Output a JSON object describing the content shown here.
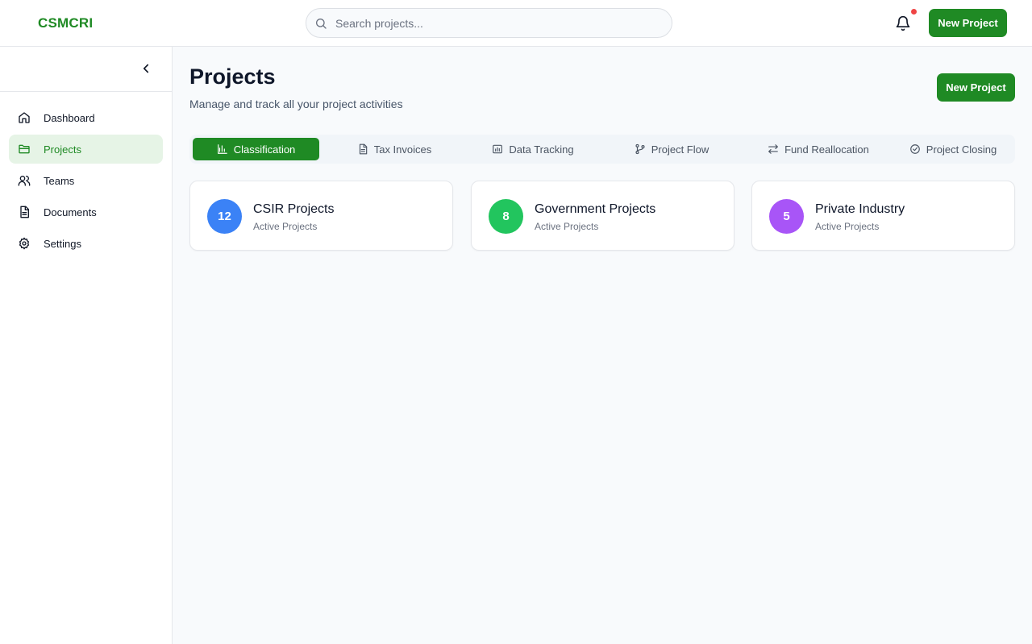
{
  "header": {
    "logo": "CSMCRI",
    "search_placeholder": "Search projects...",
    "new_project_label": "New Project"
  },
  "sidebar": {
    "items": [
      {
        "label": "Dashboard",
        "icon": "home-icon"
      },
      {
        "label": "Projects",
        "icon": "folder-icon",
        "active": true
      },
      {
        "label": "Teams",
        "icon": "users-icon"
      },
      {
        "label": "Documents",
        "icon": "document-icon"
      },
      {
        "label": "Settings",
        "icon": "gear-icon"
      }
    ]
  },
  "main": {
    "title": "Projects",
    "subtitle": "Manage and track all your project activities",
    "new_project_label": "New Project",
    "tabs": [
      {
        "label": "Classification",
        "icon": "bar-chart-icon",
        "active": true
      },
      {
        "label": "Tax Invoices",
        "icon": "file-text-icon"
      },
      {
        "label": "Data Tracking",
        "icon": "calendar-chart-icon"
      },
      {
        "label": "Project Flow",
        "icon": "git-branch-icon"
      },
      {
        "label": "Fund Reallocation",
        "icon": "swap-arrows-icon"
      },
      {
        "label": "Project Closing",
        "icon": "check-circle-icon"
      }
    ],
    "cards": [
      {
        "count": "12",
        "title": "CSIR Projects",
        "subtitle": "Active Projects",
        "color": "#3b82f6"
      },
      {
        "count": "8",
        "title": "Government Projects",
        "subtitle": "Active Projects",
        "color": "#22c55e"
      },
      {
        "count": "5",
        "title": "Private Industry",
        "subtitle": "Active Projects",
        "color": "#a855f7"
      }
    ]
  },
  "colors": {
    "brand": "#1f8a24",
    "active_nav_bg": "#e6f4e6",
    "notification_dot": "#ef4444"
  }
}
